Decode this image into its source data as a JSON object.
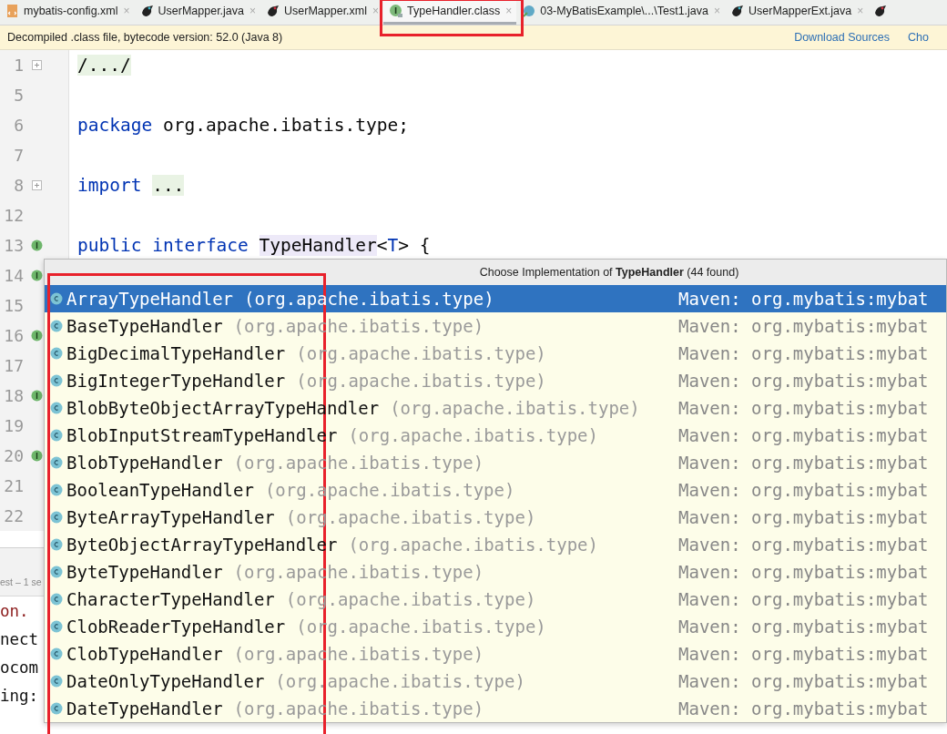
{
  "tabs": [
    {
      "label": "mybatis-config.xml",
      "kind": "xml",
      "close": "×",
      "selected": false,
      "highlighted": false
    },
    {
      "label": "UserMapper.java",
      "kind": "mapper",
      "close": "×",
      "selected": false,
      "highlighted": false
    },
    {
      "label": "UserMapper.xml",
      "kind": "mapper-xml",
      "close": "×",
      "selected": false,
      "highlighted": false
    },
    {
      "label": "TypeHandler.class",
      "kind": "interface",
      "close": "×",
      "selected": true,
      "highlighted": true
    },
    {
      "label": "03-MyBatisExample\\...\\Test1.java",
      "kind": "test",
      "close": "×",
      "selected": false,
      "highlighted": false
    },
    {
      "label": "UserMapperExt.java",
      "kind": "mapper",
      "close": "×",
      "selected": false,
      "highlighted": false
    }
  ],
  "notice": {
    "text": "Decompiled .class file, bytecode version: 52.0 (Java 8)",
    "links": [
      "Download Sources",
      "Cho"
    ]
  },
  "editor": {
    "lines": [
      {
        "number": "1",
        "fold": true,
        "marker": false,
        "tokens": [
          {
            "text": "/.../",
            "kind": "folded"
          }
        ]
      },
      {
        "number": "5",
        "fold": false,
        "marker": false
      },
      {
        "number": "6",
        "fold": false,
        "marker": false,
        "tokens": [
          {
            "text": "package",
            "kind": "keyword"
          },
          {
            "text": " org.apache.ibatis.type;",
            "kind": "plain"
          }
        ]
      },
      {
        "number": "7",
        "fold": false,
        "marker": false
      },
      {
        "number": "8",
        "fold": true,
        "marker": false,
        "tokens": [
          {
            "text": "import",
            "kind": "keyword"
          },
          {
            "text": "...",
            "kind": "folded"
          }
        ]
      },
      {
        "number": "12",
        "fold": false,
        "marker": false
      },
      {
        "number": "13",
        "fold": false,
        "marker": true,
        "tokens": [
          {
            "text": "public interface",
            "kind": "keyword"
          },
          {
            "text": "TypeHandler",
            "kind": "usage"
          },
          {
            "text": "<",
            "kind": "plain"
          },
          {
            "text": "T",
            "kind": "keyword"
          },
          {
            "text": "> {",
            "kind": "plain"
          }
        ]
      },
      {
        "number": "14",
        "fold": false,
        "marker": true
      },
      {
        "number": "15",
        "fold": false,
        "marker": false
      },
      {
        "number": "16",
        "fold": false,
        "marker": true
      },
      {
        "number": "17",
        "fold": false,
        "marker": false
      },
      {
        "number": "18",
        "fold": false,
        "marker": true
      },
      {
        "number": "19",
        "fold": false,
        "marker": false
      },
      {
        "number": "20",
        "fold": false,
        "marker": true
      },
      {
        "number": "21",
        "fold": false,
        "marker": false
      },
      {
        "number": "22",
        "fold": false,
        "marker": false
      }
    ]
  },
  "run_panel": {
    "title": "est – 1 se",
    "lines": [
      {
        "text": "on.",
        "kind": "error"
      },
      {
        "text": "nect",
        "kind": "plain"
      },
      {
        "text": "ocom",
        "kind": "plain"
      },
      {
        "text": "ing:",
        "kind": "plain"
      }
    ]
  },
  "popup": {
    "title": "Choose Implementation of **TypeHandler** (44 found)",
    "names_highlighted": true,
    "rows": [
      {
        "name": "ArrayTypeHandler",
        "package": "(org.apache.ibatis.type)",
        "source": "Maven: org.mybatis:mybat",
        "selected": true
      },
      {
        "name": "BaseTypeHandler",
        "package": "(org.apache.ibatis.type)",
        "source": "Maven: org.mybatis:mybat",
        "selected": false
      },
      {
        "name": "BigDecimalTypeHandler",
        "package": "(org.apache.ibatis.type)",
        "source": "Maven: org.mybatis:mybat",
        "selected": false
      },
      {
        "name": "BigIntegerTypeHandler",
        "package": "(org.apache.ibatis.type)",
        "source": "Maven: org.mybatis:mybat",
        "selected": false
      },
      {
        "name": "BlobByteObjectArrayTypeHandler",
        "package": "(org.apache.ibatis.type)",
        "source": "Maven: org.mybatis:mybat",
        "selected": false
      },
      {
        "name": "BlobInputStreamTypeHandler",
        "package": "(org.apache.ibatis.type)",
        "source": "Maven: org.mybatis:mybat",
        "selected": false
      },
      {
        "name": "BlobTypeHandler",
        "package": "(org.apache.ibatis.type)",
        "source": "Maven: org.mybatis:mybat",
        "selected": false
      },
      {
        "name": "BooleanTypeHandler",
        "package": "(org.apache.ibatis.type)",
        "source": "Maven: org.mybatis:mybat",
        "selected": false
      },
      {
        "name": "ByteArrayTypeHandler",
        "package": "(org.apache.ibatis.type)",
        "source": "Maven: org.mybatis:mybat",
        "selected": false
      },
      {
        "name": "ByteObjectArrayTypeHandler",
        "package": "(org.apache.ibatis.type)",
        "source": "Maven: org.mybatis:mybat",
        "selected": false
      },
      {
        "name": "ByteTypeHandler",
        "package": "(org.apache.ibatis.type)",
        "source": "Maven: org.mybatis:mybat",
        "selected": false
      },
      {
        "name": "CharacterTypeHandler",
        "package": "(org.apache.ibatis.type)",
        "source": "Maven: org.mybatis:mybat",
        "selected": false
      },
      {
        "name": "ClobReaderTypeHandler",
        "package": "(org.apache.ibatis.type)",
        "source": "Maven: org.mybatis:mybat",
        "selected": false
      },
      {
        "name": "ClobTypeHandler",
        "package": "(org.apache.ibatis.type)",
        "source": "Maven: org.mybatis:mybat",
        "selected": false
      },
      {
        "name": "DateOnlyTypeHandler",
        "package": "(org.apache.ibatis.type)",
        "source": "Maven: org.mybatis:mybat",
        "selected": false
      },
      {
        "name": "DateTypeHandler",
        "package": "(org.apache.ibatis.type)",
        "source": "Maven: org.mybatis:mybat",
        "selected": false
      }
    ]
  }
}
